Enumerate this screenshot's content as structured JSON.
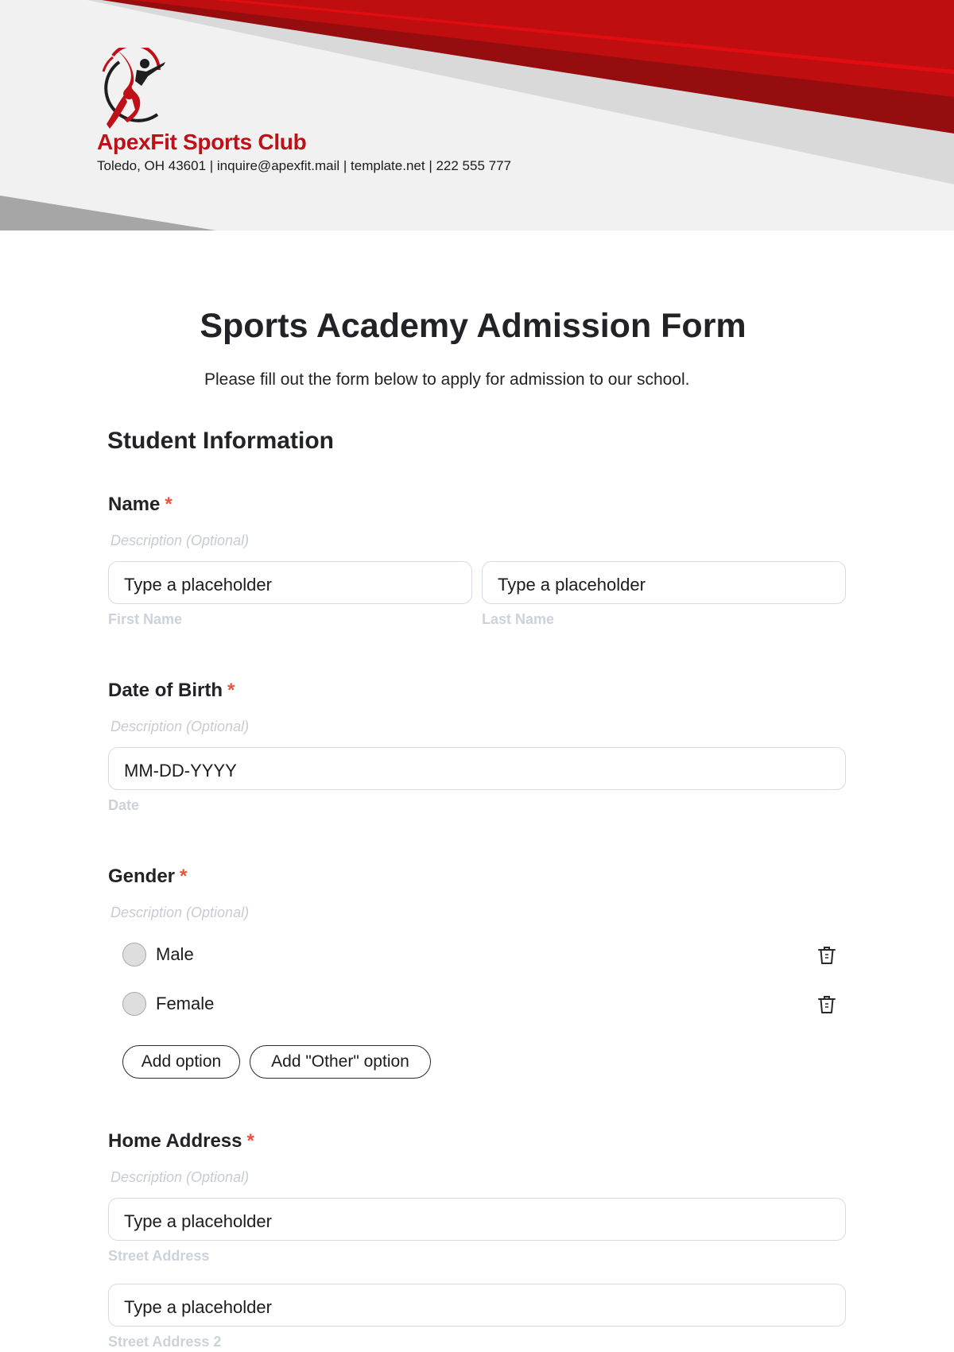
{
  "header": {
    "brand_name": "ApexFit Sports Club",
    "contact_line": "Toledo, OH 43601 | inquire@apexfit.mail | template.net | 222 555 777",
    "colors": {
      "brand_red": "#c01017",
      "dark_red": "#950d0f",
      "bright_red": "#e30c12",
      "band_gray": "#d9d9d9",
      "bg_gray": "#f1f1f1",
      "corner_gray": "#a6a6a6"
    }
  },
  "form": {
    "title": "Sports Academy Admission Form",
    "subtitle": "Please fill out the form below to apply for admission to our school.",
    "section_title": "Student Information",
    "required_marker": "*",
    "questions": {
      "name": {
        "label": "Name",
        "description": "Description (Optional)",
        "fields": [
          {
            "placeholder": "Type a placeholder",
            "sublabel": "First Name"
          },
          {
            "placeholder": "Type a placeholder",
            "sublabel": "Last Name"
          }
        ]
      },
      "dob": {
        "label": "Date of Birth",
        "description": "Description (Optional)",
        "placeholder": "MM-DD-YYYY",
        "sublabel": "Date"
      },
      "gender": {
        "label": "Gender",
        "description": "Description (Optional)",
        "options": [
          {
            "label": "Male",
            "selected": false
          },
          {
            "label": "Female",
            "selected": false
          }
        ],
        "add_option_label": "Add option",
        "add_other_label": "Add \"Other\" option"
      },
      "address": {
        "label": "Home Address",
        "description": "Description (Optional)",
        "fields": [
          {
            "placeholder": "Type a placeholder",
            "sublabel": "Street Address"
          },
          {
            "placeholder": "Type a placeholder",
            "sublabel": "Street Address 2"
          }
        ]
      }
    }
  }
}
